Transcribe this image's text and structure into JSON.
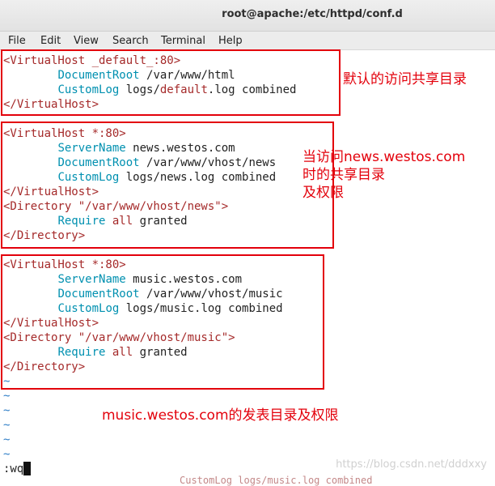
{
  "window": {
    "title": "root@apache:/etc/httpd/conf.d"
  },
  "menu": [
    "File",
    "Edit",
    "View",
    "Search",
    "Terminal",
    "Help"
  ],
  "lines": {
    "l1": {
      "tag": "<VirtualHost _default_:80>"
    },
    "l2": {
      "kw": "DocumentRoot",
      "val": " /var/www/html"
    },
    "l3": {
      "kw": "CustomLog",
      "val1": " logs/",
      "mid": "default",
      "val2": ".log combined"
    },
    "l4": {
      "tag": "</VirtualHost>"
    },
    "l5": {
      "tag": "<VirtualHost *:80>"
    },
    "l6": {
      "kw": "ServerName",
      "val": " news.westos.com"
    },
    "l7": {
      "kw": "DocumentRoot",
      "val": " /var/www/vhost/news"
    },
    "l8": {
      "kw": "CustomLog",
      "val": " logs/news.log combined"
    },
    "l9": {
      "tag": "</VirtualHost>"
    },
    "l10": {
      "tag1": "<Directory ",
      "str": "\"/var/www/vhost/news\"",
      "tag2": ">"
    },
    "l11": {
      "kw": "Require",
      "al": " all",
      "val": " granted"
    },
    "l12": {
      "tag": "</Directory>"
    },
    "l13": {
      "tag": "<VirtualHost *:80>"
    },
    "l14": {
      "kw": "ServerName",
      "val": " music.westos.com"
    },
    "l15": {
      "kw": "DocumentRoot",
      "val": " /var/www/vhost/music"
    },
    "l16": {
      "kw": "CustomLog",
      "val": " logs/music.log combined"
    },
    "l17": {
      "tag": "</VirtualHost>"
    },
    "l18": {
      "tag1": "<Directory ",
      "str": "\"/var/www/vhost/music\"",
      "tag2": ">"
    },
    "l19": {
      "kw": "Require",
      "al": " all",
      "val": " granted"
    },
    "l20": {
      "tag": "</Directory>"
    }
  },
  "tilde": "~",
  "command": ":wq",
  "annotations": {
    "default_note": "默认的访问共享目录",
    "news_note": "当访问news.westos.com\n时的共享目录\n及权限",
    "music_note": "music.westos.com的发表目录及权限"
  },
  "watermark": "https://blog.csdn.net/dddxxy",
  "ghost_text": "CustomLog logs/music.log combined",
  "colors": {
    "annotation": "#e3000b",
    "tag": "#a52a2a",
    "keyword": "#0090b0",
    "tilde": "#2f7ec7"
  }
}
